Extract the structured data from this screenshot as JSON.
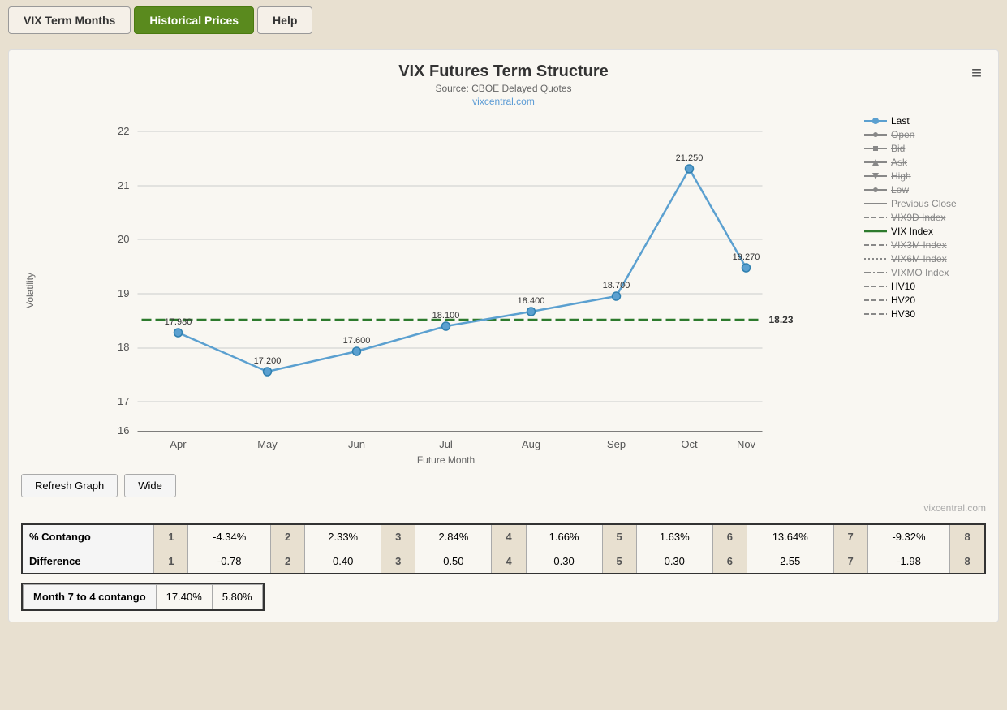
{
  "nav": {
    "tabs": [
      {
        "label": "VIX Term Months",
        "active": false
      },
      {
        "label": "Historical Prices",
        "active": true
      },
      {
        "label": "Help",
        "active": false
      }
    ]
  },
  "chart": {
    "title": "VIX Futures Term Structure",
    "source": "Source: CBOE Delayed Quotes",
    "link": "vixcentral.com",
    "hamburger": "≡",
    "y_label": "Volatility",
    "x_label": "Future Month",
    "vix_index_value": "18.23",
    "data_points": [
      {
        "month": "Apr",
        "value": 17.98
      },
      {
        "month": "May",
        "value": 17.2
      },
      {
        "month": "Jun",
        "value": 17.6
      },
      {
        "month": "Jul",
        "value": 18.1
      },
      {
        "month": "Aug",
        "value": 18.4
      },
      {
        "month": "Sep",
        "value": 18.7
      },
      {
        "month": "Oct",
        "value": 21.25
      },
      {
        "month": "Nov",
        "value": 19.27
      }
    ],
    "vix_line": 18.23,
    "y_min": 16,
    "y_max": 22,
    "legend": [
      {
        "label": "Last",
        "type": "line-dot",
        "color": "#5ba0d0",
        "active": true
      },
      {
        "label": "Open",
        "type": "line-dot",
        "color": "#888",
        "active": false,
        "strike": true
      },
      {
        "label": "Bid",
        "type": "line-square",
        "color": "#888",
        "active": false,
        "strike": true
      },
      {
        "label": "Ask",
        "type": "line-tri",
        "color": "#888",
        "active": false,
        "strike": true
      },
      {
        "label": "High",
        "type": "line-down",
        "color": "#888",
        "active": false,
        "strike": true
      },
      {
        "label": "Low",
        "type": "line-dot",
        "color": "#888",
        "active": false,
        "strike": true
      },
      {
        "label": "Previous Close",
        "type": "line",
        "color": "#888",
        "active": false,
        "strike": true
      },
      {
        "label": "VIX9D Index",
        "type": "dashed",
        "color": "#888",
        "active": false,
        "strike": true
      },
      {
        "label": "VIX Index",
        "type": "solid",
        "color": "#2d7a2d",
        "active": true
      },
      {
        "label": "VIX3M Index",
        "type": "dashed",
        "color": "#888",
        "active": false,
        "strike": true
      },
      {
        "label": "VIX6M Index",
        "type": "dotted",
        "color": "#888",
        "active": false,
        "strike": true
      },
      {
        "label": "VIXMO Index",
        "type": "dashdot",
        "color": "#888",
        "active": false,
        "strike": true
      },
      {
        "label": "HV10",
        "type": "dashed",
        "color": "#888",
        "active": false,
        "strike": false
      },
      {
        "label": "HV20",
        "type": "dashed",
        "color": "#888",
        "active": false,
        "strike": false
      },
      {
        "label": "HV30",
        "type": "dashed",
        "color": "#888",
        "active": false,
        "strike": false
      }
    ]
  },
  "buttons": {
    "refresh": "Refresh Graph",
    "wide": "Wide"
  },
  "attribution": "vixcentral.com",
  "contango_row": {
    "label": "% Contango",
    "cells": [
      {
        "num": "1",
        "val": "-4.34%"
      },
      {
        "num": "2",
        "val": "2.33%"
      },
      {
        "num": "3",
        "val": "2.84%"
      },
      {
        "num": "4",
        "val": "1.66%"
      },
      {
        "num": "5",
        "val": "1.63%"
      },
      {
        "num": "6",
        "val": "13.64%"
      },
      {
        "num": "7",
        "val": "-9.32%"
      },
      {
        "num": "8",
        "val": ""
      }
    ]
  },
  "difference_row": {
    "label": "Difference",
    "cells": [
      {
        "num": "1",
        "val": "-0.78"
      },
      {
        "num": "2",
        "val": "0.40"
      },
      {
        "num": "3",
        "val": "0.50"
      },
      {
        "num": "4",
        "val": "0.30"
      },
      {
        "num": "5",
        "val": "0.30"
      },
      {
        "num": "6",
        "val": "2.55"
      },
      {
        "num": "7",
        "val": "-1.98"
      },
      {
        "num": "8",
        "val": ""
      }
    ]
  },
  "month_contango": {
    "label": "Month 7 to 4 contango",
    "val1": "17.40%",
    "val2": "5.80%"
  }
}
